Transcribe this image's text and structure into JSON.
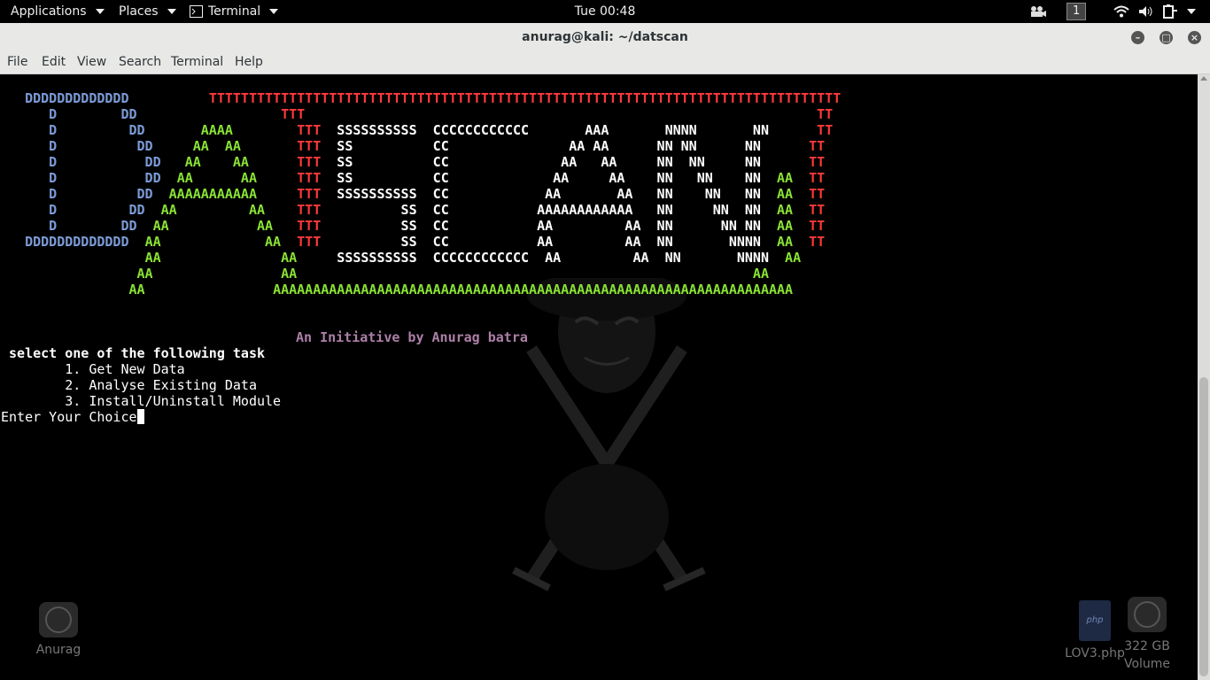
{
  "topbar": {
    "applications": "Applications",
    "places": "Places",
    "terminal": "Terminal",
    "clock": "Tue 00:48",
    "workspace": "1"
  },
  "window": {
    "title": "anurag@kali: ~/datscan"
  },
  "menubar": [
    "File",
    "Edit",
    "View",
    "Search",
    "Terminal",
    "Help"
  ],
  "terminal": {
    "banner_rows": [
      [
        [
          "b",
          "   DDDDDDDDDDDDD"
        ],
        [
          "w",
          "          "
        ],
        [
          "r",
          "TTTTTTTTTTTTTTTTTTTTTTTTTTTTTTTTTTTTTTTTTTTTTTTTTTTTTTTTTTTTTTTTTTTTTTTTTTTTTTT"
        ]
      ],
      [
        [
          "b",
          "      D        DD"
        ],
        [
          "w",
          "                  "
        ],
        [
          "r",
          "TTT"
        ],
        [
          "w",
          "                                                                "
        ],
        [
          "r",
          "TT"
        ]
      ],
      [
        [
          "b",
          "      D         DD"
        ],
        [
          "w",
          "       "
        ],
        [
          "g",
          "AAAA"
        ],
        [
          "w",
          "        "
        ],
        [
          "r",
          "TTT"
        ],
        [
          "w",
          "  SSSSSSSSSS  CCCCCCCCCCCC       AAA       NNNN       NN      "
        ],
        [
          "r",
          "TT"
        ]
      ],
      [
        [
          "b",
          "      D          DD"
        ],
        [
          "w",
          "     "
        ],
        [
          "g",
          "AA  AA"
        ],
        [
          "w",
          "       "
        ],
        [
          "r",
          "TTT"
        ],
        [
          "w",
          "  SS          CC               AA AA      NN NN      NN      "
        ],
        [
          "r",
          "TT"
        ]
      ],
      [
        [
          "b",
          "      D           DD"
        ],
        [
          "w",
          "   "
        ],
        [
          "g",
          "AA    AA"
        ],
        [
          "w",
          "      "
        ],
        [
          "r",
          "TTT"
        ],
        [
          "w",
          "  SS          CC              AA   AA     NN  NN     NN      "
        ],
        [
          "r",
          "TT"
        ]
      ],
      [
        [
          "b",
          "      D           DD"
        ],
        [
          "w",
          "  "
        ],
        [
          "g",
          "AA      AA"
        ],
        [
          "w",
          "     "
        ],
        [
          "r",
          "TTT"
        ],
        [
          "w",
          "  SS          CC             AA     AA    NN   NN    NN  "
        ],
        [
          "g",
          "AA"
        ],
        [
          "w",
          "  "
        ],
        [
          "r",
          "TT"
        ]
      ],
      [
        [
          "b",
          "      D          DD"
        ],
        [
          "w",
          "  "
        ],
        [
          "g",
          "AAAAAAAAAAA"
        ],
        [
          "w",
          "     "
        ],
        [
          "r",
          "TTT"
        ],
        [
          "w",
          "  SSSSSSSSSS  CC            AA       AA   NN    NN   NN  "
        ],
        [
          "g",
          "AA"
        ],
        [
          "w",
          "  "
        ],
        [
          "r",
          "TT"
        ]
      ],
      [
        [
          "b",
          "      D         DD"
        ],
        [
          "w",
          "  "
        ],
        [
          "g",
          "AA         AA"
        ],
        [
          "w",
          "    "
        ],
        [
          "r",
          "TTT"
        ],
        [
          "w",
          "          SS  CC           AAAAAAAAAAAA   NN     NN  NN  "
        ],
        [
          "g",
          "AA"
        ],
        [
          "w",
          "  "
        ],
        [
          "r",
          "TT"
        ]
      ],
      [
        [
          "b",
          "      D        DD"
        ],
        [
          "w",
          "  "
        ],
        [
          "g",
          "AA           AA"
        ],
        [
          "w",
          "   "
        ],
        [
          "r",
          "TTT"
        ],
        [
          "w",
          "          SS  CC           AA         AA  NN      NN NN  "
        ],
        [
          "g",
          "AA"
        ],
        [
          "w",
          "  "
        ],
        [
          "r",
          "TT"
        ]
      ],
      [
        [
          "b",
          "   DDDDDDDDDDDDD"
        ],
        [
          "w",
          "  "
        ],
        [
          "g",
          "AA             AA"
        ],
        [
          "w",
          "  "
        ],
        [
          "r",
          "TTT"
        ],
        [
          "w",
          "          SS  CC           AA         AA  NN       NNNN  "
        ],
        [
          "g",
          "AA"
        ],
        [
          "w",
          "  "
        ],
        [
          "r",
          "TT"
        ]
      ],
      [
        [
          "w",
          "                  "
        ],
        [
          "g",
          "AA               AA"
        ],
        [
          "w",
          "     SSSSSSSSSS  CCCCCCCCCCCC  AA         AA  NN       NNNN  "
        ],
        [
          "g",
          "AA"
        ]
      ],
      [
        [
          "w",
          "                 "
        ],
        [
          "g",
          "AA"
        ],
        [
          "w",
          "                "
        ],
        [
          "g",
          "AA"
        ],
        [
          "w",
          "                                                         "
        ],
        [
          "g",
          "AA"
        ]
      ],
      [
        [
          "w",
          "                "
        ],
        [
          "g",
          "AA"
        ],
        [
          "w",
          "                "
        ],
        [
          "g",
          "AAAAAAAAAAAAAAAAAAAAAAAAAAAAAAAAAAAAAAAAAAAAAAAAAAAAAAAAAAAAAAAAA"
        ]
      ]
    ],
    "initiative": "An Initiative by Anurag batra",
    "prompt_title": " select one of the following task",
    "options": [
      "        1. Get New Data",
      "        2. Analyse Existing Data",
      "        3. Install/Uninstall Module"
    ],
    "input_prompt": "Enter Your Choice"
  },
  "desktop_icons": [
    {
      "label": "Anurag"
    },
    {
      "label": "LOV3.php",
      "badge": "php"
    },
    {
      "label": "322 GB Volume"
    }
  ]
}
